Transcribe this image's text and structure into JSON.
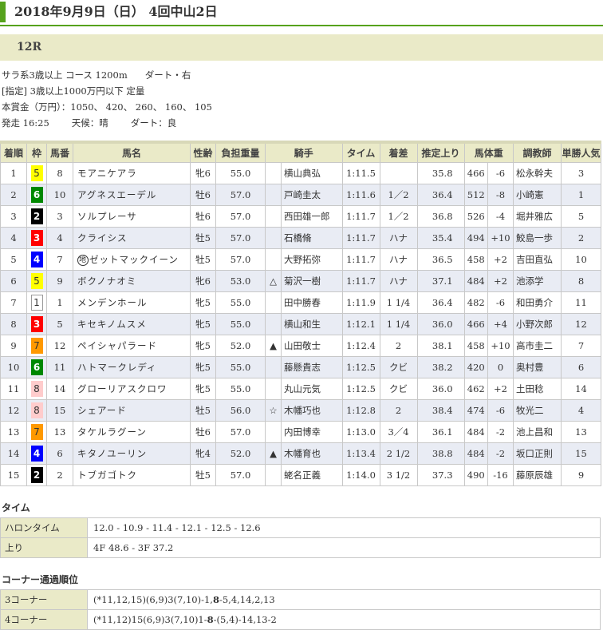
{
  "header": {
    "title": "2018年9月9日（日） 4回中山2日",
    "race_number": "12R"
  },
  "race_info": {
    "line1_a": "サラ系3歳以上 コース 1200m",
    "line1_b": "ダート・右",
    "line2": "[指定] 3歳以上1000万円以下 定量",
    "line3": "本賞金（万円）：1050、 420、 260、 160、 105",
    "start": "発走 16:25",
    "weather": "天候：晴",
    "track": "ダート：良"
  },
  "table": {
    "columns": [
      "着順",
      "枠",
      "馬番",
      "馬名",
      "性齢",
      "負担重量",
      "騎手",
      "タイム",
      "着差",
      "推定上り",
      "馬体重",
      "調教師",
      "単勝人気"
    ],
    "rows": [
      {
        "rank": "1",
        "waku": "5",
        "num": "8",
        "name": "モアニケアラ",
        "prefix": "",
        "sexage": "牝6",
        "weight": "55.0",
        "mark": "",
        "jockey": "横山典弘",
        "time": "1:11.5",
        "margin": "",
        "last3f": "35.8",
        "body": "466",
        "diff": "-6",
        "trainer": "松永幹夫",
        "pop": "3"
      },
      {
        "rank": "2",
        "waku": "6",
        "num": "10",
        "name": "アグネスエーデル",
        "prefix": "",
        "sexage": "牡6",
        "weight": "57.0",
        "mark": "",
        "jockey": "戸崎圭太",
        "time": "1:11.6",
        "margin": "1／2",
        "last3f": "36.4",
        "body": "512",
        "diff": "-8",
        "trainer": "小崎憲",
        "pop": "1"
      },
      {
        "rank": "3",
        "waku": "2",
        "num": "3",
        "name": "ソルプレーサ",
        "prefix": "",
        "sexage": "牡6",
        "weight": "57.0",
        "mark": "",
        "jockey": "西田雄一郎",
        "time": "1:11.7",
        "margin": "1／2",
        "last3f": "36.8",
        "body": "526",
        "diff": "-4",
        "trainer": "堀井雅広",
        "pop": "5"
      },
      {
        "rank": "4",
        "waku": "3",
        "num": "4",
        "name": "クライシス",
        "prefix": "",
        "sexage": "牡5",
        "weight": "57.0",
        "mark": "",
        "jockey": "石橋脩",
        "time": "1:11.7",
        "margin": "ハナ",
        "last3f": "35.4",
        "body": "494",
        "diff": "+10",
        "trainer": "鮫島一歩",
        "pop": "2"
      },
      {
        "rank": "5",
        "waku": "4",
        "num": "7",
        "name": "ゼットマックイーン",
        "prefix": "地",
        "sexage": "牡5",
        "weight": "57.0",
        "mark": "",
        "jockey": "大野拓弥",
        "time": "1:11.7",
        "margin": "ハナ",
        "last3f": "36.5",
        "body": "458",
        "diff": "+2",
        "trainer": "吉田直弘",
        "pop": "10"
      },
      {
        "rank": "6",
        "waku": "5",
        "num": "9",
        "name": "ボクノナオミ",
        "prefix": "",
        "sexage": "牝6",
        "weight": "53.0",
        "mark": "△",
        "jockey": "菊沢一樹",
        "time": "1:11.7",
        "margin": "ハナ",
        "last3f": "37.1",
        "body": "484",
        "diff": "+2",
        "trainer": "池添学",
        "pop": "8"
      },
      {
        "rank": "7",
        "waku": "1",
        "num": "1",
        "name": "メンデンホール",
        "prefix": "",
        "sexage": "牝5",
        "weight": "55.0",
        "mark": "",
        "jockey": "田中勝春",
        "time": "1:11.9",
        "margin": "1 1/4",
        "last3f": "36.4",
        "body": "482",
        "diff": "-6",
        "trainer": "和田勇介",
        "pop": "11"
      },
      {
        "rank": "8",
        "waku": "3",
        "num": "5",
        "name": "キセキノムスメ",
        "prefix": "",
        "sexage": "牝5",
        "weight": "55.0",
        "mark": "",
        "jockey": "横山和生",
        "time": "1:12.1",
        "margin": "1 1/4",
        "last3f": "36.0",
        "body": "466",
        "diff": "+4",
        "trainer": "小野次郎",
        "pop": "12"
      },
      {
        "rank": "9",
        "waku": "7",
        "num": "12",
        "name": "ペイシャパラード",
        "prefix": "",
        "sexage": "牝5",
        "weight": "52.0",
        "mark": "▲",
        "jockey": "山田敬士",
        "time": "1:12.4",
        "margin": "2",
        "last3f": "38.1",
        "body": "458",
        "diff": "+10",
        "trainer": "高市圭二",
        "pop": "7"
      },
      {
        "rank": "10",
        "waku": "6",
        "num": "11",
        "name": "ハトマークレディ",
        "prefix": "",
        "sexage": "牝5",
        "weight": "55.0",
        "mark": "",
        "jockey": "藤懸貴志",
        "time": "1:12.5",
        "margin": "クビ",
        "last3f": "38.2",
        "body": "420",
        "diff": "0",
        "trainer": "奥村豊",
        "pop": "6"
      },
      {
        "rank": "11",
        "waku": "8",
        "num": "14",
        "name": "グローリアスクロワ",
        "prefix": "",
        "sexage": "牝5",
        "weight": "55.0",
        "mark": "",
        "jockey": "丸山元気",
        "time": "1:12.5",
        "margin": "クビ",
        "last3f": "36.0",
        "body": "462",
        "diff": "+2",
        "trainer": "土田稔",
        "pop": "14"
      },
      {
        "rank": "12",
        "waku": "8",
        "num": "15",
        "name": "シェアード",
        "prefix": "",
        "sexage": "牡5",
        "weight": "56.0",
        "mark": "☆",
        "jockey": "木幡巧也",
        "time": "1:12.8",
        "margin": "2",
        "last3f": "38.4",
        "body": "474",
        "diff": "-6",
        "trainer": "牧光二",
        "pop": "4"
      },
      {
        "rank": "13",
        "waku": "7",
        "num": "13",
        "name": "タケルラグーン",
        "prefix": "",
        "sexage": "牡6",
        "weight": "57.0",
        "mark": "",
        "jockey": "内田博幸",
        "time": "1:13.0",
        "margin": "3／4",
        "last3f": "36.1",
        "body": "484",
        "diff": "-2",
        "trainer": "池上昌和",
        "pop": "13"
      },
      {
        "rank": "14",
        "waku": "4",
        "num": "6",
        "name": "キタノユーリン",
        "prefix": "",
        "sexage": "牝4",
        "weight": "52.0",
        "mark": "▲",
        "jockey": "木幡育也",
        "time": "1:13.4",
        "margin": "2 1/2",
        "last3f": "38.8",
        "body": "484",
        "diff": "-2",
        "trainer": "坂口正則",
        "pop": "15"
      },
      {
        "rank": "15",
        "waku": "2",
        "num": "2",
        "name": "トブガゴトク",
        "prefix": "",
        "sexage": "牡5",
        "weight": "57.0",
        "mark": "",
        "jockey": "蛯名正義",
        "time": "1:14.0",
        "margin": "3 1/2",
        "last3f": "37.3",
        "body": "490",
        "diff": "-16",
        "trainer": "藤原辰雄",
        "pop": "9"
      }
    ]
  },
  "time_section": {
    "heading": "タイム",
    "furlong_label": "ハロンタイム",
    "furlong_value": "12.0 - 10.9 - 11.4 - 12.1 - 12.5 - 12.6",
    "agari_label": "上り",
    "agari_value": "4F 48.6 - 3F 37.2"
  },
  "corner_section": {
    "heading": "コーナー通過順位",
    "c3_label": "3コーナー",
    "c3_pre": "(*11,12,15)(6,9)3(7,10)-1,",
    "c3_bold": "8",
    "c3_post": "-5,4,14,2,13",
    "c4_label": "4コーナー",
    "c4_pre": "(*11,12)15(6,9)3(7,10)1-",
    "c4_bold": "8",
    "c4_post": "-(5,4)-14,13-2"
  }
}
